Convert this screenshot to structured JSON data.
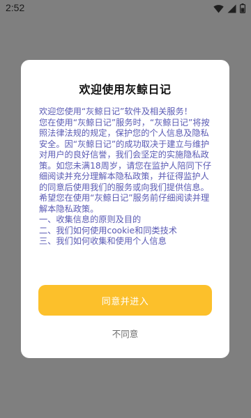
{
  "status_bar": {
    "time": "2:52",
    "icons": [
      "wifi-icon",
      "signal-icon",
      "battery-icon"
    ]
  },
  "dialog": {
    "title": "欢迎使用灰鲸日记",
    "paragraphs": [
      "欢迎您使用“灰鲸日记”软件及相关服务！",
      "您在使用“灰鲸日记”服务时，“灰鲸日记”将按照法律法规的规定，保护您的个人信息及隐私安全。因“灰鲸日记”的成功取决于建立与维护对用户的良好信誉，我们会坚定的实施隐私政策。如您未满18周岁，请您在监护人陪同下仔细阅读并充分理解本隐私政策，并征得监护人的同意后使用我们的服务或向我们提供信息。",
      "希望您在使用“灰鲸日记”服务前仔细阅读并理解本隐私政策。",
      "一、收集信息的原则及目的",
      "二、我们如何使用cookie和同类技术",
      "三、我们如何收集和使用个人信息"
    ],
    "agree_label": "同意并进入",
    "disagree_label": "不同意"
  },
  "colors": {
    "overlay": "#7f7f7f",
    "accent": "#fcc02b",
    "body_text": "#5a5ab4"
  }
}
